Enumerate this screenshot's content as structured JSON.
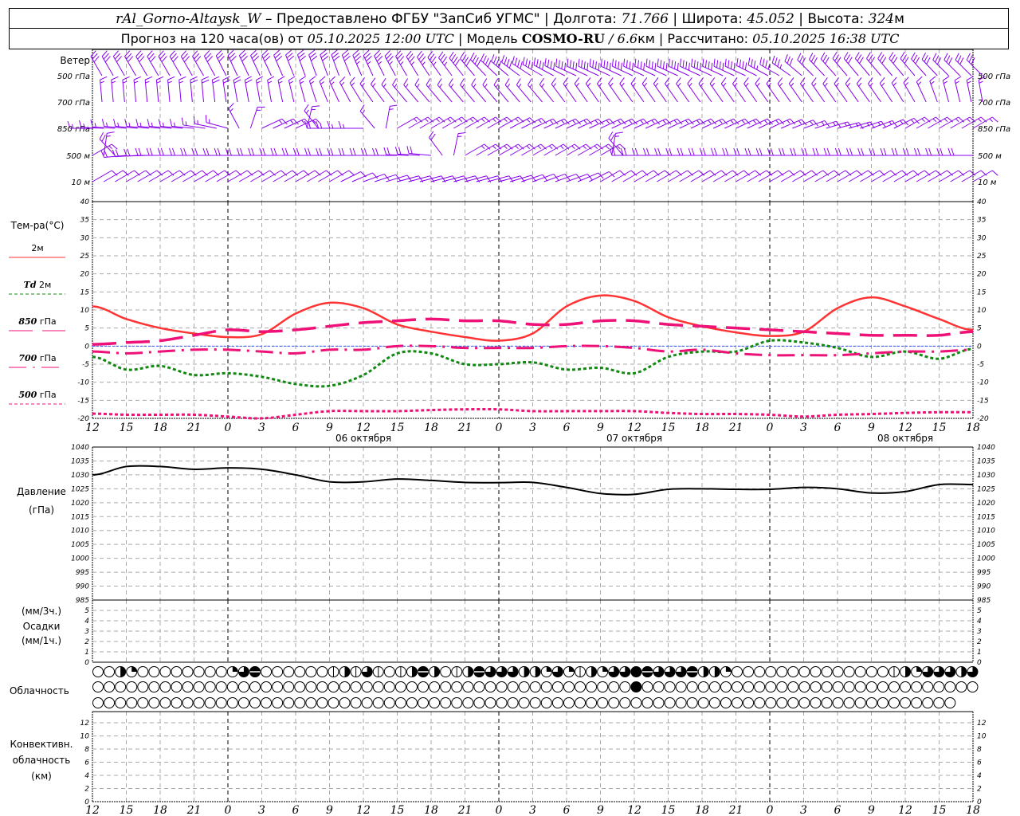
{
  "header": {
    "station": "rAl_Gorno-Altaysk_W",
    "provider": " – Предоставлено ФГБУ \"ЗапСиб УГМС\" | Долгота: ",
    "longitude": "71.766",
    "lat_label": " | Широта: ",
    "latitude": "45.052",
    "alt_label": " | Высота: ",
    "altitude": "324",
    "alt_unit": "м",
    "forecast_label": "Прогноз на 120 часа(ов) от ",
    "forecast_start": "05.10.2025 12:00 UTC",
    "model_label": " | Модель ",
    "model": "COSMO-RU",
    "resolution": " / 6.6",
    "res_unit": "км",
    "calc_label": " | Рассчитано: ",
    "calc_time": "05.10.2025 16:38 UTC"
  },
  "labels": {
    "wind": "Ветер",
    "wind_levels": [
      "500 гПа",
      "700 гПа",
      "850 гПа",
      "500 м",
      "10  м"
    ],
    "temp_title": "Тем-ра(°C)",
    "legend": [
      {
        "prefix": "",
        "name": "2м",
        "color": "#ff3333",
        "dash": ""
      },
      {
        "prefix": "Td",
        "name": " 2м",
        "color": "#118811",
        "dash": "4,3"
      },
      {
        "prefix": "850",
        "name": " гПа",
        "color": "#ee1177",
        "dash": "30,12"
      },
      {
        "prefix": "700",
        "name": " гПа",
        "color": "#ee1177",
        "dash": "22,8,3,8"
      },
      {
        "prefix": "500",
        "name": " гПа",
        "color": "#ee1177",
        "dash": "4,3"
      }
    ],
    "pressure": [
      "Давление",
      "(гПа)"
    ],
    "precip": [
      "(мм/3ч.)",
      "Осадки",
      "(мм/1ч.)"
    ],
    "cloud": "Облачность",
    "convective": [
      "Конвективн.",
      "облачность",
      "(км)"
    ]
  },
  "chart_data": [
    {
      "type": "barbs",
      "title": "Ветер",
      "hours_utc": [
        12,
        15,
        18,
        21,
        0,
        3,
        6,
        9,
        12,
        15,
        18,
        21,
        0,
        3,
        6,
        9,
        12,
        15,
        18,
        21,
        0,
        3,
        6,
        9,
        12,
        15,
        18
      ],
      "levels": [
        {
          "name": "500 гПа",
          "dir": [
            330,
            330,
            330,
            330,
            335,
            335,
            340,
            340,
            335,
            330,
            325,
            320,
            310,
            300,
            295,
            295,
            295,
            295,
            295,
            295,
            300,
            315,
            320,
            320,
            320,
            315,
            315
          ],
          "speed_kt": [
            30,
            30,
            30,
            30,
            30,
            30,
            30,
            30,
            35,
            35,
            35,
            40,
            40,
            40,
            40,
            40,
            40,
            40,
            40,
            40,
            35,
            30,
            30,
            30,
            30,
            30,
            30
          ]
        },
        {
          "name": "700 гПа",
          "dir": [
            355,
            355,
            355,
            355,
            350,
            350,
            345,
            335,
            325,
            320,
            320,
            320,
            320,
            320,
            325,
            325,
            325,
            325,
            325,
            325,
            325,
            325,
            325,
            325,
            330,
            345,
            350
          ],
          "speed_kt": [
            15,
            15,
            15,
            20,
            20,
            15,
            15,
            15,
            15,
            15,
            15,
            15,
            15,
            15,
            15,
            15,
            15,
            15,
            15,
            15,
            15,
            15,
            15,
            15,
            15,
            15,
            15
          ]
        },
        {
          "name": "850 гПа",
          "dir": [
            270,
            275,
            275,
            275,
            285,
            65,
            65,
            270,
            270,
            60,
            60,
            60,
            60,
            65,
            65,
            65,
            65,
            65,
            65,
            65,
            65,
            70,
            75,
            70,
            60,
            60,
            60
          ],
          "speed_kt": [
            15,
            15,
            15,
            15,
            15,
            15,
            15,
            15,
            15,
            15,
            15,
            15,
            15,
            15,
            15,
            15,
            15,
            15,
            15,
            15,
            15,
            15,
            15,
            15,
            15,
            15,
            15
          ]
        },
        {
          "name": "500 м",
          "dir": [
            60,
            265,
            270,
            270,
            270,
            270,
            270,
            270,
            270,
            270,
            275,
            60,
            60,
            60,
            60,
            60,
            270,
            270,
            270,
            270,
            270,
            270,
            270,
            270,
            270,
            270,
            270
          ],
          "speed_kt": [
            15,
            20,
            20,
            20,
            20,
            20,
            20,
            20,
            20,
            20,
            20,
            15,
            15,
            15,
            15,
            15,
            20,
            20,
            20,
            20,
            20,
            20,
            20,
            20,
            20,
            20,
            20
          ]
        },
        {
          "name": "10  м",
          "dir": [
            60,
            60,
            60,
            60,
            60,
            60,
            60,
            60,
            70,
            75,
            75,
            75,
            75,
            70,
            70,
            60,
            60,
            60,
            60,
            60,
            60,
            60,
            60,
            60,
            60,
            60,
            60
          ],
          "speed_kt": [
            10,
            10,
            10,
            10,
            10,
            10,
            10,
            10,
            10,
            10,
            10,
            10,
            10,
            10,
            10,
            10,
            10,
            10,
            10,
            10,
            10,
            10,
            10,
            10,
            10,
            10,
            10
          ]
        }
      ]
    },
    {
      "type": "line",
      "ylabel": "Тем-ра(°C)",
      "ylim": [
        -20,
        40
      ],
      "yticks": [
        -20,
        -15,
        -10,
        -5,
        0,
        5,
        10,
        15,
        20,
        25,
        30,
        35,
        40
      ],
      "x_tick_labels": [
        "12",
        "15",
        "18",
        "21",
        "0",
        "3",
        "6",
        "9",
        "12",
        "15",
        "18",
        "21",
        "0",
        "3",
        "6",
        "9",
        "12",
        "15",
        "18",
        "21",
        "0",
        "3",
        "6",
        "9",
        "12",
        "15",
        "18"
      ],
      "date_labels": [
        "06 октября",
        "07 октября",
        "08 октября"
      ],
      "grid": true,
      "series": [
        {
          "name": "2м",
          "color": "#ff3333",
          "values": [
            11,
            7.5,
            5,
            3.5,
            2.5,
            3.3,
            9,
            12,
            10.5,
            6,
            4,
            2.5,
            1.5,
            3.5,
            11,
            14,
            12.5,
            8,
            5.5,
            3.8,
            2.8,
            4,
            10.5,
            13.5,
            11,
            7.5,
            4.5
          ]
        },
        {
          "name": "Td 2м",
          "color": "#118811",
          "values": [
            -3,
            -6.5,
            -5.5,
            -8,
            -7.5,
            -8.5,
            -10.5,
            -11,
            -8,
            -2,
            -2,
            -5,
            -5,
            -4.5,
            -6.5,
            -6,
            -7.5,
            -3,
            -1.5,
            -1.5,
            1.5,
            1,
            -0.5,
            -3,
            -1.5,
            -3.5,
            -0.8
          ]
        },
        {
          "name": "850 гПа",
          "color": "#ee1177",
          "values": [
            0.5,
            1,
            1.5,
            3,
            4.5,
            4,
            4.5,
            5.5,
            6.5,
            7,
            7.5,
            7,
            7,
            6,
            6,
            7,
            7,
            6,
            5.5,
            5,
            4.5,
            4,
            3.5,
            3,
            3,
            3,
            4
          ]
        },
        {
          "name": "700 гПа",
          "color": "#ee1177",
          "values": [
            -1.5,
            -2,
            -1.5,
            -1,
            -1,
            -1.5,
            -2,
            -1,
            -1,
            0,
            0,
            -0.5,
            -0.5,
            -0.5,
            0,
            0,
            -0.5,
            -1.5,
            -1,
            -2,
            -2.5,
            -2.5,
            -2.5,
            -2,
            -1.5,
            -1.5,
            -1
          ]
        },
        {
          "name": "500 гПа",
          "color": "#ee1177",
          "values": [
            -18.7,
            -19,
            -19,
            -19,
            -19.5,
            -20,
            -19,
            -18,
            -18,
            -18,
            -17.7,
            -17.5,
            -17.5,
            -18,
            -18,
            -18,
            -18,
            -18.5,
            -18.8,
            -18.8,
            -19,
            -19.5,
            -19,
            -18.8,
            -18.5,
            -18.3,
            -18.3
          ]
        }
      ]
    },
    {
      "type": "line",
      "ylabel": "Давление (гПа)",
      "ylim": [
        985,
        1040
      ],
      "yticks": [
        985,
        990,
        995,
        1000,
        1005,
        1010,
        1015,
        1020,
        1025,
        1030,
        1035,
        1040
      ],
      "series": [
        {
          "values": [
            1030,
            1033,
            1033,
            1032,
            1032.5,
            1032,
            1030,
            1027.5,
            1027.5,
            1028.5,
            1028,
            1027.3,
            1027.2,
            1027.3,
            1025.5,
            1023.3,
            1023,
            1024.8,
            1025,
            1024.8,
            1024.8,
            1025.5,
            1025,
            1023.5,
            1024,
            1026.5,
            1026.5
          ]
        }
      ]
    },
    {
      "type": "bar",
      "ylabel": "Осадки",
      "ylim": [
        0,
        5
      ],
      "yticks": [
        0,
        1,
        2,
        3,
        4,
        5
      ],
      "values": []
    },
    {
      "type": "table",
      "title": "Облачность",
      "octas_rows": [
        [
          0,
          0,
          4,
          2,
          0,
          0,
          0,
          0,
          0,
          0,
          0,
          0,
          2,
          6,
          7,
          0,
          0,
          0,
          0,
          0,
          0,
          1,
          4,
          1,
          6,
          1,
          0,
          1,
          4,
          7,
          4,
          0,
          1,
          4,
          7,
          6,
          6,
          6,
          4,
          4,
          2,
          6,
          2,
          1,
          4,
          2,
          6,
          6,
          8,
          7,
          6,
          6,
          6,
          7,
          4,
          4,
          2,
          0,
          0,
          0,
          0,
          0,
          0,
          0,
          0,
          0,
          0,
          0,
          0,
          0,
          0,
          1,
          4,
          2,
          6,
          6,
          6,
          4,
          6
        ],
        [
          0,
          0,
          0,
          0,
          0,
          0,
          0,
          0,
          0,
          0,
          0,
          0,
          0,
          0,
          0,
          0,
          0,
          0,
          0,
          0,
          0,
          0,
          0,
          0,
          0,
          0,
          0,
          0,
          0,
          0,
          0,
          0,
          0,
          0,
          0,
          0,
          0,
          0,
          0,
          0,
          0,
          0,
          0,
          0,
          0,
          0,
          0,
          0,
          8,
          0,
          0,
          0,
          0,
          0,
          0,
          0,
          0,
          0,
          0,
          0,
          0,
          0,
          0,
          0,
          0,
          0,
          0,
          0,
          0,
          0,
          0,
          0,
          0,
          0,
          0,
          0,
          0,
          0,
          0
        ],
        [
          0,
          0,
          0,
          0,
          0,
          0,
          0,
          0,
          0,
          0,
          0,
          0,
          0,
          0,
          0,
          0,
          0,
          0,
          0,
          0,
          0,
          0,
          0,
          0,
          0,
          0,
          0,
          0,
          0,
          0,
          0,
          0,
          0,
          0,
          0,
          0,
          0,
          0,
          0,
          0,
          0,
          0,
          0,
          0,
          0,
          0,
          0,
          0,
          0,
          0,
          0,
          0,
          0,
          0,
          0,
          0,
          0,
          0,
          0,
          0,
          0,
          0,
          0,
          0,
          0,
          0,
          0,
          0,
          0,
          0,
          0,
          0,
          0,
          0,
          0,
          0,
          0
        ]
      ]
    },
    {
      "type": "bar",
      "ylabel": "Конвективн. облачность (км)",
      "ylim": [
        0,
        14
      ],
      "yticks": [
        0,
        2,
        4,
        6,
        8,
        10,
        12
      ],
      "values": []
    }
  ],
  "colors": {
    "wind": "#8800ee",
    "grid": "#aaaaaa",
    "axis": "#000000",
    "zero_line": "#3355ff"
  }
}
